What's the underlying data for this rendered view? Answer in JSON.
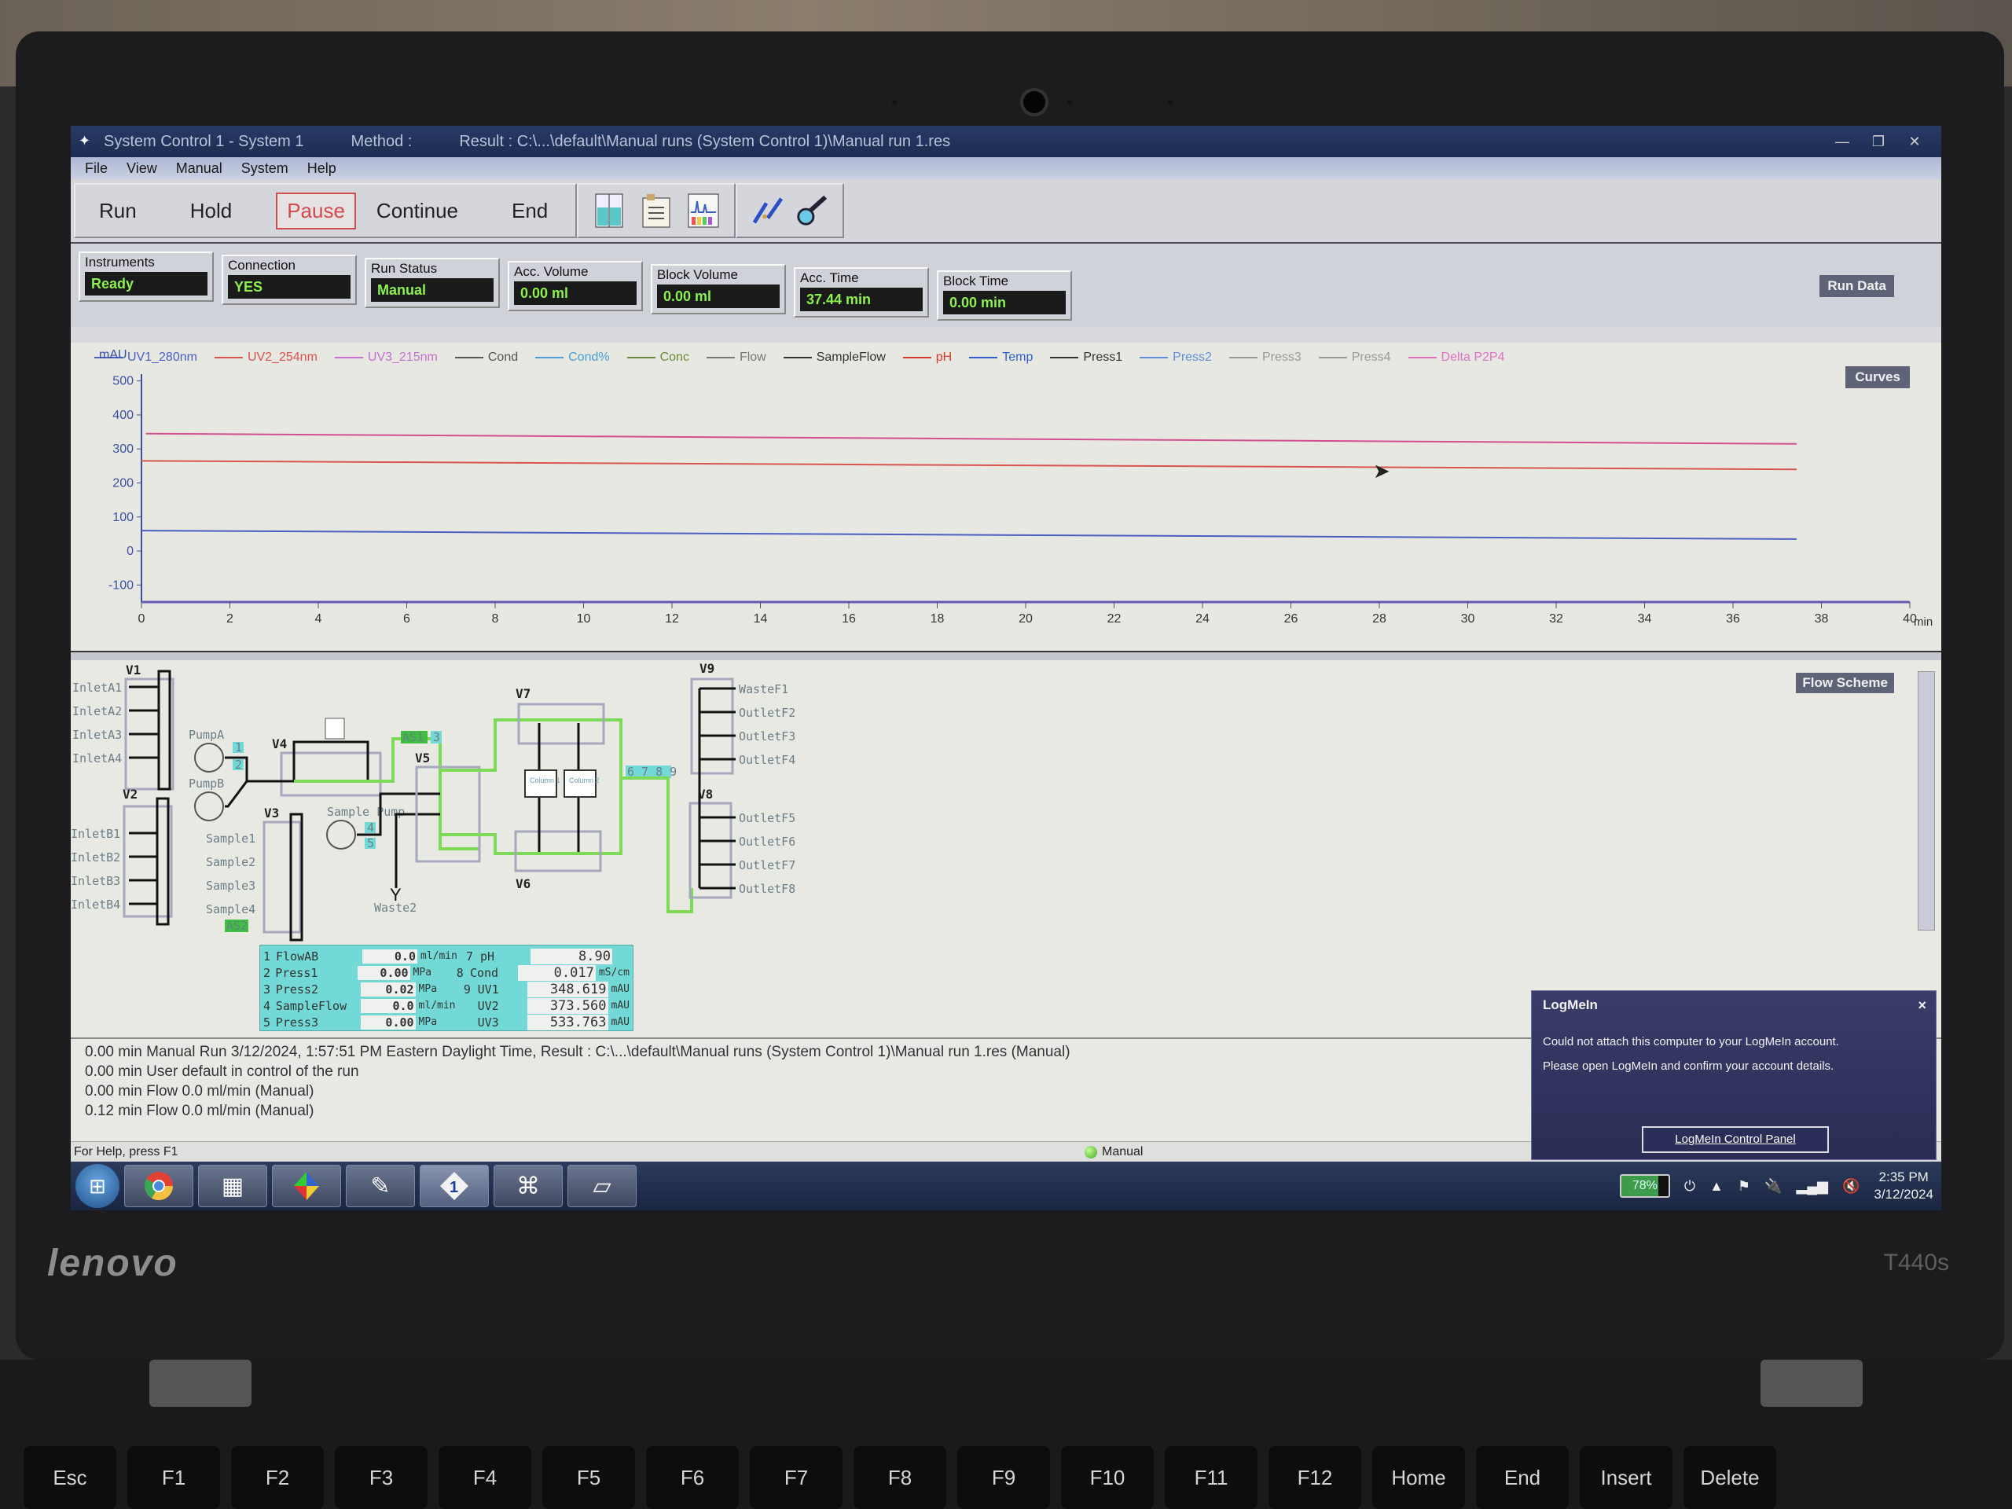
{
  "device": {
    "brand": "lenovo",
    "model": "T440s"
  },
  "window": {
    "title": "System Control 1 - System 1",
    "method": "Method :",
    "result": "Result : C:\\...\\default\\Manual runs (System Control 1)\\Manual run 1.res"
  },
  "window_controls": {
    "minimize": "—",
    "restore": "❐",
    "close": "✕"
  },
  "menu": [
    "File",
    "View",
    "Manual",
    "System",
    "Help"
  ],
  "toolbar": {
    "run": "Run",
    "hold": "Hold",
    "pause": "Pause",
    "continue": "Continue",
    "end": "End",
    "icons": [
      "layout-icon",
      "list-icon",
      "chromatogram-icon",
      "connect-icon",
      "probe-icon"
    ]
  },
  "status": [
    {
      "label": "Instruments",
      "value": "Ready"
    },
    {
      "label": "Connection",
      "value": "YES"
    },
    {
      "label": "Run Status",
      "value": "Manual"
    },
    {
      "label": "Acc. Volume",
      "value": "0.00  ml"
    },
    {
      "label": "Block Volume",
      "value": "0.00  ml"
    },
    {
      "label": "Acc. Time",
      "value": "37.44  min"
    },
    {
      "label": "Block Time",
      "value": "0.00  min"
    }
  ],
  "tabs": {
    "run_data": "Run Data",
    "curves": "Curves",
    "flow_scheme": "Flow Scheme"
  },
  "chart_data": {
    "type": "line",
    "title": "",
    "xlabel": "min",
    "ylabel": "mAU",
    "xlim": [
      0,
      40
    ],
    "ylim": [
      -150,
      520
    ],
    "x_ticks": [
      0,
      2,
      4,
      6,
      8,
      10,
      12,
      14,
      16,
      18,
      20,
      22,
      24,
      26,
      28,
      30,
      32,
      34,
      36,
      38,
      40
    ],
    "y_ticks": [
      -100,
      0,
      100,
      200,
      300,
      400,
      500
    ],
    "grid": false,
    "legend_position": "top",
    "legend": [
      {
        "name": "UV1_280nm",
        "color": "#4a5fc1"
      },
      {
        "name": "UV2_254nm",
        "color": "#d9534f"
      },
      {
        "name": "UV3_215nm",
        "color": "#c56fd0"
      },
      {
        "name": "Cond",
        "color": "#555555"
      },
      {
        "name": "Cond%",
        "color": "#4a9fd8"
      },
      {
        "name": "Conc",
        "color": "#6a8a3a"
      },
      {
        "name": "Flow",
        "color": "#777777"
      },
      {
        "name": "SampleFlow",
        "color": "#333333"
      },
      {
        "name": "pH",
        "color": "#d93b2b"
      },
      {
        "name": "Temp",
        "color": "#2f5fcf"
      },
      {
        "name": "Press1",
        "color": "#333333"
      },
      {
        "name": "Press2",
        "color": "#5f8fd8"
      },
      {
        "name": "Press3",
        "color": "#999999"
      },
      {
        "name": "Press4",
        "color": "#999999"
      },
      {
        "name": "Delta P2P4",
        "color": "#e070c0"
      }
    ],
    "series": [
      {
        "name": "UV3_215nm",
        "color": "#d0508f",
        "x": [
          0.1,
          37.44
        ],
        "values": [
          345,
          315
        ]
      },
      {
        "name": "UV2_254nm",
        "color": "#d9534f",
        "x": [
          0,
          37.44
        ],
        "values": [
          265,
          240
        ]
      },
      {
        "name": "UV1_280nm",
        "color": "#4a5fc1",
        "x": [
          0,
          37.44
        ],
        "values": [
          60,
          35
        ]
      }
    ]
  },
  "flow_scheme": {
    "valves": [
      "V1",
      "V2",
      "V3",
      "V4",
      "V5",
      "V6",
      "V7",
      "V8",
      "V9"
    ],
    "inlets_a": [
      "InletA1",
      "InletA2",
      "InletA3",
      "InletA4"
    ],
    "inlets_b": [
      "InletB1",
      "InletB2",
      "InletB3",
      "InletB4"
    ],
    "samples": [
      "Sample1",
      "Sample2",
      "Sample3",
      "Sample4"
    ],
    "outlets_v9": [
      "WasteF1",
      "OutletF2",
      "OutletF3",
      "OutletF4"
    ],
    "outlets_v8": [
      "OutletF5",
      "OutletF6",
      "OutletF7",
      "OutletF8"
    ],
    "pumps": [
      "PumpA",
      "PumpB",
      "Sample Pump"
    ],
    "columns": [
      "Column 1",
      "Column 2"
    ],
    "waste": "Waste2",
    "badges": [
      "AS1",
      "AS2"
    ],
    "sensor_numbers": [
      "1",
      "2",
      "3",
      "4",
      "5",
      "6 7 8 9"
    ]
  },
  "readout": {
    "left": [
      {
        "idx": "1",
        "name": "FlowAB",
        "value": "0.0",
        "unit": "ml/min"
      },
      {
        "idx": "2",
        "name": "Press1",
        "value": "0.00",
        "unit": "MPa"
      },
      {
        "idx": "3",
        "name": "Press2",
        "value": "0.02",
        "unit": "MPa"
      },
      {
        "idx": "4",
        "name": "SampleFlow",
        "value": "0.0",
        "unit": "ml/min"
      },
      {
        "idx": "5",
        "name": "Press3",
        "value": "0.00",
        "unit": "MPa"
      }
    ],
    "right": [
      {
        "idx": "7",
        "name": "pH",
        "value": "8.90",
        "unit": ""
      },
      {
        "idx": "8",
        "name": "Cond",
        "value": "0.017",
        "unit": "mS/cm"
      },
      {
        "idx": "9",
        "name": "UV1",
        "value": "348.619",
        "unit": "mAU"
      },
      {
        "idx": "",
        "name": "UV2",
        "value": "373.560",
        "unit": "mAU"
      },
      {
        "idx": "",
        "name": "UV3",
        "value": "533.763",
        "unit": "mAU"
      }
    ]
  },
  "log": [
    "0.00 min Manual Run 3/12/2024, 1:57:51 PM Eastern Daylight Time, Result : C:\\...\\default\\Manual runs (System Control 1)\\Manual run 1.res (Manual)",
    "0.00 min User default in control of the run",
    "0.00 min Flow    0.0 ml/min (Manual)",
    "0.12 min Flow    0.0 ml/min (Manual)"
  ],
  "statusbar": {
    "help": "For Help, press F1",
    "mode": "Manual"
  },
  "popup": {
    "title": "LogMeIn",
    "close": "×",
    "message1": "Could not attach this computer to your LogMeIn account.",
    "message2": "Please open LogMeIn and confirm your account details.",
    "button": "LogMeIn Control Panel"
  },
  "taskbar": {
    "apps": [
      "windows-start",
      "chrome",
      "control-panel",
      "unicorn-manager",
      "method-editor",
      "system-control",
      "evaluation",
      "notepad"
    ],
    "battery": "78%",
    "time": "2:35 PM",
    "date": "3/12/2024"
  },
  "keyboard": [
    "Esc",
    "F1",
    "F2",
    "F3",
    "F4",
    "F5",
    "F6",
    "F7",
    "F8",
    "F9",
    "F10",
    "F11",
    "F12",
    "Home",
    "End",
    "Insert",
    "Delete"
  ]
}
